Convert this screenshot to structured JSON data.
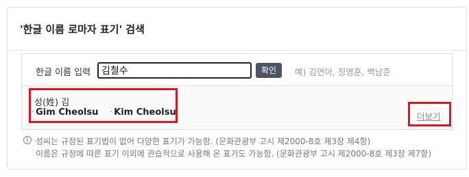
{
  "panel": {
    "title": "'한글 이름 로마자 표기' 검색"
  },
  "search": {
    "label": "한글 이름 입력",
    "value": "김철수",
    "confirm_label": "확인",
    "example": "예) 김연아, 정명훈, 백남준"
  },
  "result": {
    "surname": "성(姓) 김",
    "romanizations": [
      "Gim Cheolsu",
      "Kim Cheolsu"
    ],
    "more_label": "더보기"
  },
  "notes": [
    "성씨는 규정된 표기법이 없어 다양한 표기가 가능함. (문화관광부 고시 제2000-8호 제3장 제4항)",
    "이름은 규정에 따른 표기 이외에 관습적으로 사용해 온 표기도 가능함. (문화관광부 고시 제2000-8호 제3장 제7항)"
  ],
  "colors": {
    "highlight": "#e0141e",
    "button": "#4b5366"
  }
}
